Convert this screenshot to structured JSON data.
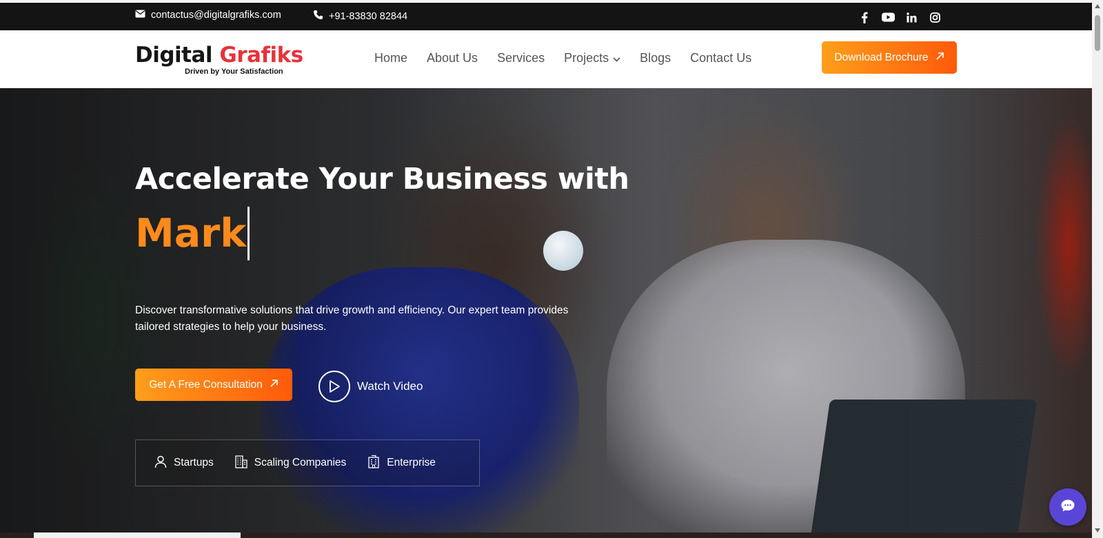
{
  "topbar": {
    "email": "contactus@digitalgrafiks.com",
    "phone": "+91-83830 82844",
    "socials": [
      "facebook-icon",
      "youtube-icon",
      "linkedin-icon",
      "instagram-icon"
    ]
  },
  "brand": {
    "name_part1": "Digital ",
    "name_part2": "Grafiks",
    "tagline": "Driven by Your Satisfaction"
  },
  "nav": {
    "items": [
      "Home",
      "About Us",
      "Services",
      "Projects",
      "Blogs",
      "Contact Us"
    ],
    "cta": "Download Brochure"
  },
  "hero": {
    "headline": "Accelerate Your Business with",
    "rotating_word": "Mark",
    "description": "Discover transformative solutions that drive growth and efficiency. Our expert team provides tailored strategies to help your business.",
    "cta": "Get A Free Consultation",
    "video_label": "Watch Video",
    "segments": [
      "Startups",
      "Scaling Companies",
      "Enterprise"
    ]
  },
  "colors": {
    "accent_start": "#ff9e1b",
    "accent_end": "#ff5a0a",
    "brand_red": "#e6333b",
    "chat": "#5a46d6"
  }
}
